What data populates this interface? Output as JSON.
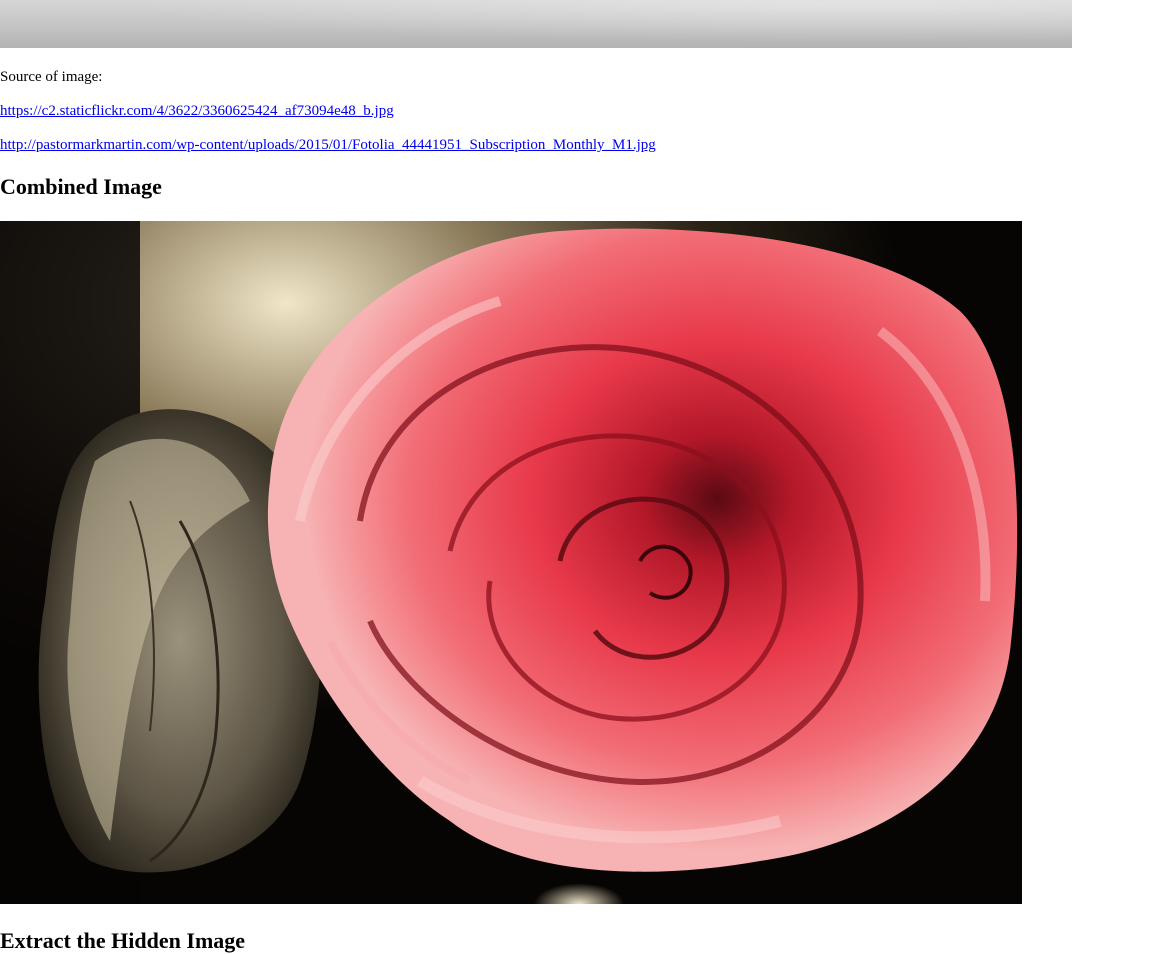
{
  "source": {
    "label": "Source of image:",
    "links": [
      "https://c2.staticflickr.com/4/3622/3360625424_af73094e48_b.jpg",
      "http://pastormarkmartin.com/wp-content/uploads/2015/01/Fotolia_44441951_Subscription_Monthly_M1.jpg"
    ]
  },
  "sections": {
    "combined_heading": "Combined Image",
    "extract_heading": "Extract the Hidden Image"
  },
  "colors": {
    "link": "#0000ee",
    "rose_red": "#e8394a",
    "rose_highlight": "#f7a8a8",
    "sepia_light": "#e9dfc3",
    "background_dark": "#0a0805"
  }
}
